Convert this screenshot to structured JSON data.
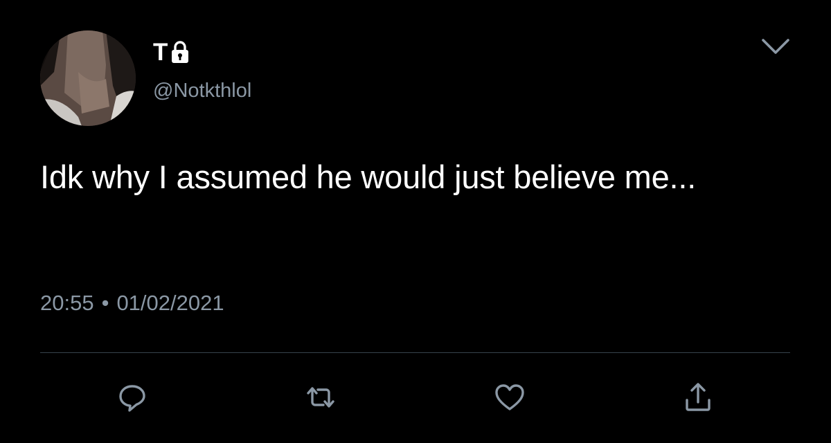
{
  "author": {
    "display_name": "T",
    "handle": "@Notkthlol"
  },
  "tweet": {
    "text": "Idk why I assumed he would just believe me...",
    "time": "20:55",
    "separator": "•",
    "date": "01/02/2021"
  },
  "icons": {
    "lock": "lock-icon",
    "more": "chevron-down-icon",
    "reply": "reply-icon",
    "retweet": "retweet-icon",
    "like": "heart-icon",
    "share": "share-icon"
  },
  "colors": {
    "background": "#000000",
    "primary_text": "#ffffff",
    "secondary_text": "#8b98a5",
    "divider": "#38444d",
    "icon": "#8b98a5"
  }
}
